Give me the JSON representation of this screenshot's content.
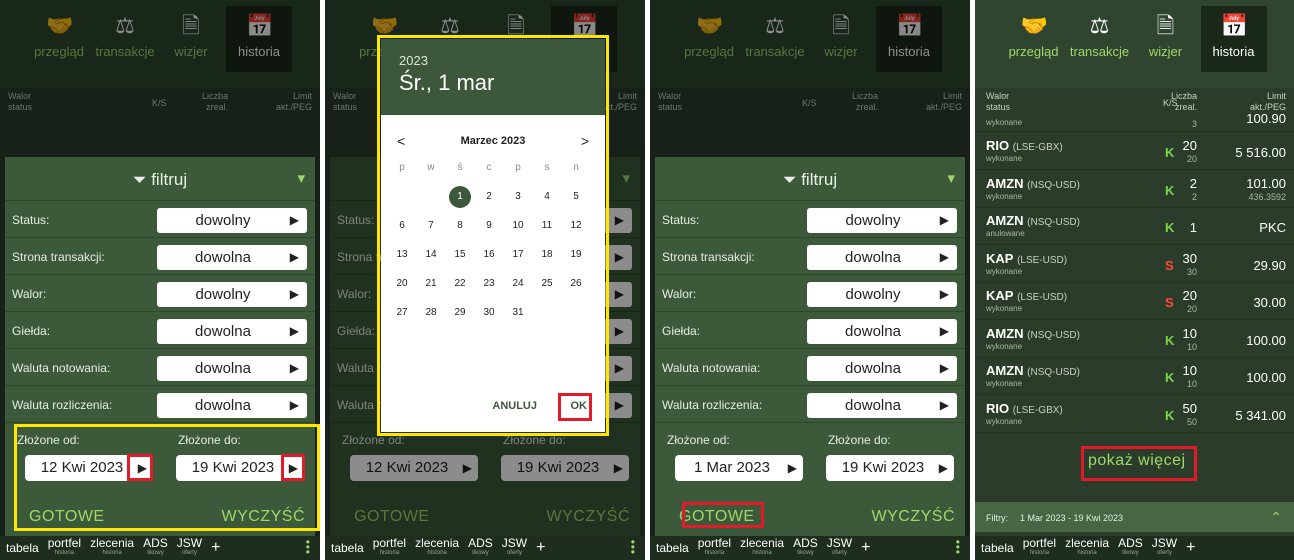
{
  "nav": {
    "overview": "przegląd",
    "transactions": "transakcje",
    "viewer": "wizjer",
    "history": "historia"
  },
  "columns": {
    "instrument": "Walor",
    "status": "status",
    "side": "K/S",
    "qty_line1": "Liczba",
    "qty_line2": "zreal.",
    "limit_line1": "Limit",
    "limit_line2": "akt./PEG"
  },
  "filter": {
    "title": "filtruj",
    "rows": [
      {
        "label": "Status:",
        "value": "dowolny"
      },
      {
        "label": "Strona transakcji:",
        "value": "dowolna"
      },
      {
        "label": "Walor:",
        "value": "dowolny"
      },
      {
        "label": "Giełda:",
        "value": "dowolna"
      },
      {
        "label": "Waluta notowania:",
        "value": "dowolna"
      },
      {
        "label": "Waluta rozliczenia:",
        "value": "dowolna"
      }
    ],
    "from_label": "Złożone od:",
    "to_label": "Złożone do:",
    "done": "GOTOWE",
    "clear": "WYCZYŚĆ"
  },
  "panel1": {
    "from_value": "12 Kwi 2023",
    "to_value": "19 Kwi 2023"
  },
  "panel3": {
    "from_value": "1 Mar 2023",
    "to_value": "19 Kwi 2023"
  },
  "datepicker": {
    "year": "2023",
    "selected_date": "Śr., 1 mar",
    "month": "Marzec 2023",
    "prev": "<",
    "next": ">",
    "weekdays": [
      "p",
      "w",
      "ś",
      "c",
      "p",
      "s",
      "n"
    ],
    "cancel": "ANULUJ",
    "ok": "OK"
  },
  "bottomnav": {
    "table": "tabela",
    "portfolio": "portfel",
    "portfolio_sub": "historia",
    "orders": "zlecenia",
    "orders_sub": "historia",
    "ads": "ADS",
    "ads_sub": "tikowy",
    "jsw": "JSW",
    "jsw_sub": "oferty",
    "plus": "+"
  },
  "history": {
    "first_status": "wykonane",
    "first_qty2": "3",
    "first_limit": "100.90",
    "rows": [
      {
        "symbol": "RIO",
        "market": "(LSE-GBX)",
        "status": "wykonane",
        "side": "K",
        "qty": "20",
        "qty2": "20",
        "limit": "5 516.00",
        "limit2": ""
      },
      {
        "symbol": "AMZN",
        "market": "(NSQ-USD)",
        "status": "wykonane",
        "side": "K",
        "qty": "2",
        "qty2": "2",
        "limit": "101.00",
        "limit2": "436.3592"
      },
      {
        "symbol": "AMZN",
        "market": "(NSQ-USD)",
        "status": "anulowane",
        "side": "K",
        "qty": "1",
        "qty2": "",
        "limit": "PKC",
        "limit2": ""
      },
      {
        "symbol": "KAP",
        "market": "(LSE-USD)",
        "status": "wykonane",
        "side": "S",
        "qty": "30",
        "qty2": "30",
        "limit": "29.90",
        "limit2": ""
      },
      {
        "symbol": "KAP",
        "market": "(LSE-USD)",
        "status": "wykonane",
        "side": "S",
        "qty": "20",
        "qty2": "20",
        "limit": "30.00",
        "limit2": ""
      },
      {
        "symbol": "AMZN",
        "market": "(NSQ-USD)",
        "status": "wykonane",
        "side": "K",
        "qty": "10",
        "qty2": "10",
        "limit": "100.00",
        "limit2": ""
      },
      {
        "symbol": "AMZN",
        "market": "(NSQ-USD)",
        "status": "wykonane",
        "side": "K",
        "qty": "10",
        "qty2": "10",
        "limit": "100.00",
        "limit2": ""
      },
      {
        "symbol": "RIO",
        "market": "(LSE-GBX)",
        "status": "wykonane",
        "side": "K",
        "qty": "50",
        "qty2": "50",
        "limit": "5 341.00",
        "limit2": ""
      }
    ],
    "show_more": "pokaż więcej",
    "filters_label": "Filtry:",
    "filters_value": "1 Mar 2023 - 19 Kwi 2023"
  },
  "colors": {
    "buy": "#79d64a",
    "sell": "#ff4a33",
    "accent": "#9fd86a",
    "highlight_yellow": "#ffe600",
    "highlight_red": "#e21a2a"
  }
}
